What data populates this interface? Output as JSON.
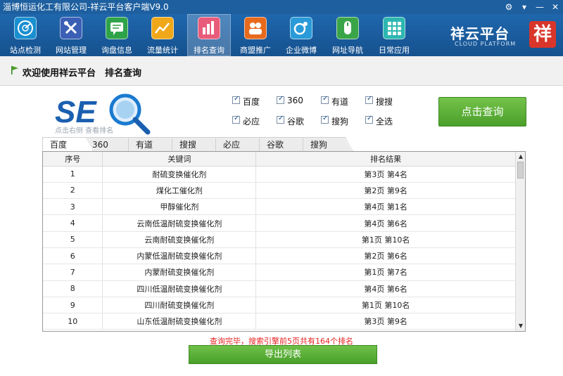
{
  "window": {
    "title": "淄博恒运化工有限公司-祥云平台客户端V9.0",
    "controls": [
      "⚙",
      "▾",
      "—",
      "✕"
    ]
  },
  "toolbar": [
    {
      "label": "站点检测",
      "icon": "radar-icon",
      "color": "#1a8fd0"
    },
    {
      "label": "网站管理",
      "icon": "tools-icon",
      "color": "#3b5fb5"
    },
    {
      "label": "询盘信息",
      "icon": "message-icon",
      "color": "#2fa34a"
    },
    {
      "label": "流量统计",
      "icon": "trend-icon",
      "color": "#f0a81a"
    },
    {
      "label": "排名查询",
      "icon": "bar-chart-icon",
      "color": "#e85b7a"
    },
    {
      "label": "商盟推广",
      "icon": "handshake-icon",
      "color": "#e76a1c"
    },
    {
      "label": "企业微博",
      "icon": "weibo-icon",
      "color": "#2a9bd8"
    },
    {
      "label": "网址导航",
      "icon": "mouse-icon",
      "color": "#3aa548"
    },
    {
      "label": "日常应用",
      "icon": "grid-icon",
      "color": "#2db7b0"
    }
  ],
  "brand": {
    "name": "祥云平台",
    "english": "CLOUD PLATFORM",
    "seal": "祥"
  },
  "page": {
    "title": "欢迎使用祥云平台　排名查询"
  },
  "logo": {
    "text": "SEO",
    "subtitle": "点击右侧 查看排名"
  },
  "engines": {
    "row1": [
      "百度",
      "360",
      "有道",
      "搜搜"
    ],
    "row2": [
      "必应",
      "谷歌",
      "搜狗",
      "全选"
    ]
  },
  "query_button": "点击查询",
  "tabs": [
    "百度",
    "360",
    "有道",
    "搜搜",
    "必应",
    "谷歌",
    "搜狗"
  ],
  "table": {
    "headers": [
      "序号",
      "关键词",
      "排名结果"
    ],
    "rows": [
      [
        "1",
        "耐硫变换催化剂",
        "第3页 第4名"
      ],
      [
        "2",
        "煤化工催化剂",
        "第2页 第9名"
      ],
      [
        "3",
        "甲醇催化剂",
        "第4页 第1名"
      ],
      [
        "4",
        "云南低温耐硫变换催化剂",
        "第4页 第6名"
      ],
      [
        "5",
        "云南耐硫变换催化剂",
        "第1页 第10名"
      ],
      [
        "6",
        "内蒙低温耐硫变换催化剂",
        "第2页 第6名"
      ],
      [
        "7",
        "内蒙耐硫变换催化剂",
        "第1页 第7名"
      ],
      [
        "8",
        "四川低温耐硫变换催化剂",
        "第4页 第6名"
      ],
      [
        "9",
        "四川耐硫变换催化剂",
        "第1页 第10名"
      ],
      [
        "10",
        "山东低温耐硫变换催化剂",
        "第3页 第9名"
      ]
    ]
  },
  "status": "查询完毕，搜索引擎前5页共有164个排名",
  "export_button": "导出列表"
}
